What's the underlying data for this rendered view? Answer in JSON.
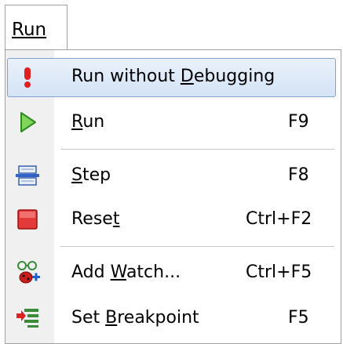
{
  "menubar": {
    "title": "Run"
  },
  "menu": {
    "items": [
      {
        "label_pre": "Run without ",
        "label_mnemonic": "D",
        "label_post": "ebugging",
        "shortcut": "",
        "icon": "exclamation-icon"
      },
      {
        "label_pre": "",
        "label_mnemonic": "R",
        "label_post": "un",
        "shortcut": "F9",
        "icon": "play-icon"
      },
      {
        "label_pre": "",
        "label_mnemonic": "S",
        "label_post": "tep",
        "shortcut": "F8",
        "icon": "step-icon"
      },
      {
        "label_pre": "Rese",
        "label_mnemonic": "t",
        "label_post": "",
        "shortcut": "Ctrl+F2",
        "icon": "stop-icon"
      },
      {
        "label_pre": "Add ",
        "label_mnemonic": "W",
        "label_post": "atch...",
        "shortcut": "Ctrl+F5",
        "icon": "watch-icon"
      },
      {
        "label_pre": "Set ",
        "label_mnemonic": "B",
        "label_post": "reakpoint",
        "shortcut": "F5",
        "icon": "breakpoint-icon"
      }
    ]
  },
  "colors": {
    "highlight_border": "#7da2ce",
    "highlight_fill": "#d4e3f6",
    "gutter": "#f0f0f0",
    "accent_red": "#e02020",
    "accent_green": "#2ea82e"
  }
}
